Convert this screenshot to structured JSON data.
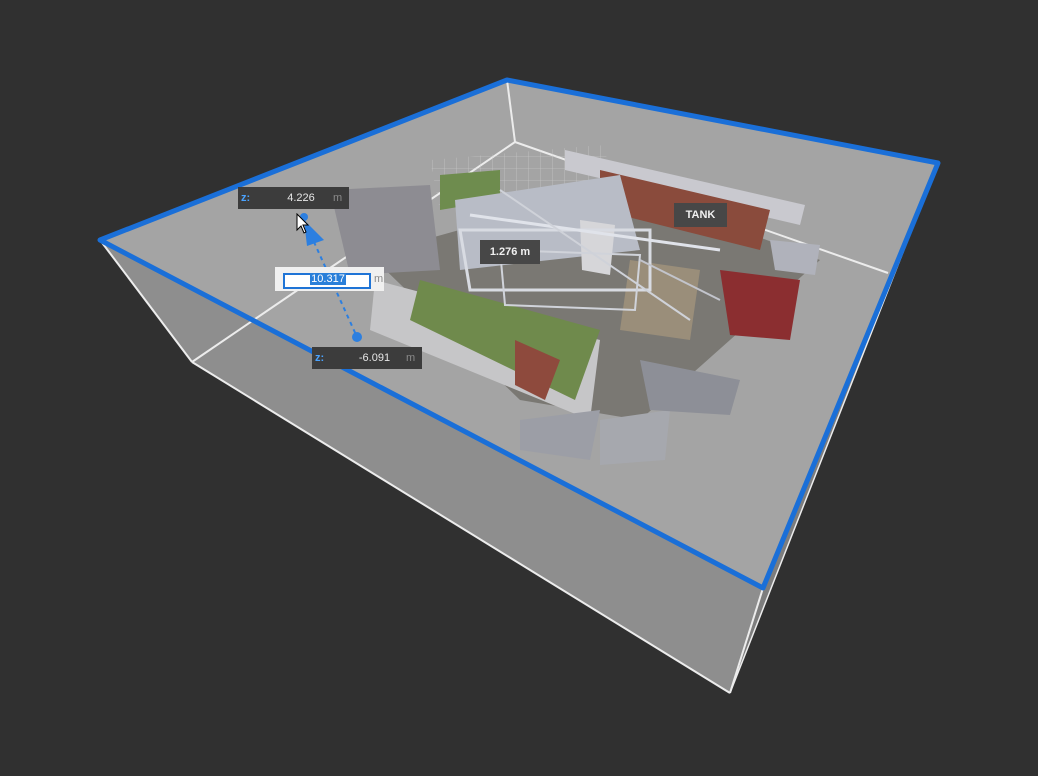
{
  "z_top": {
    "axis": "z:",
    "value": "4.226",
    "unit": "m"
  },
  "size_input": {
    "value": "10.317",
    "unit": "m"
  },
  "z_bottom": {
    "axis": "z:",
    "value": "-6.091",
    "unit": "m"
  },
  "measurement_label": "1.276 m",
  "object_label": "TANK",
  "colors": {
    "background": "#303030",
    "clip_box_top_edge": "#1a6fd8",
    "clip_box_faces": "#9a9a9a",
    "accent": "#4aa3ff"
  },
  "icons": [
    "move-handle-top-icon",
    "move-handle-bottom-icon",
    "mouse-pointer-icon"
  ]
}
